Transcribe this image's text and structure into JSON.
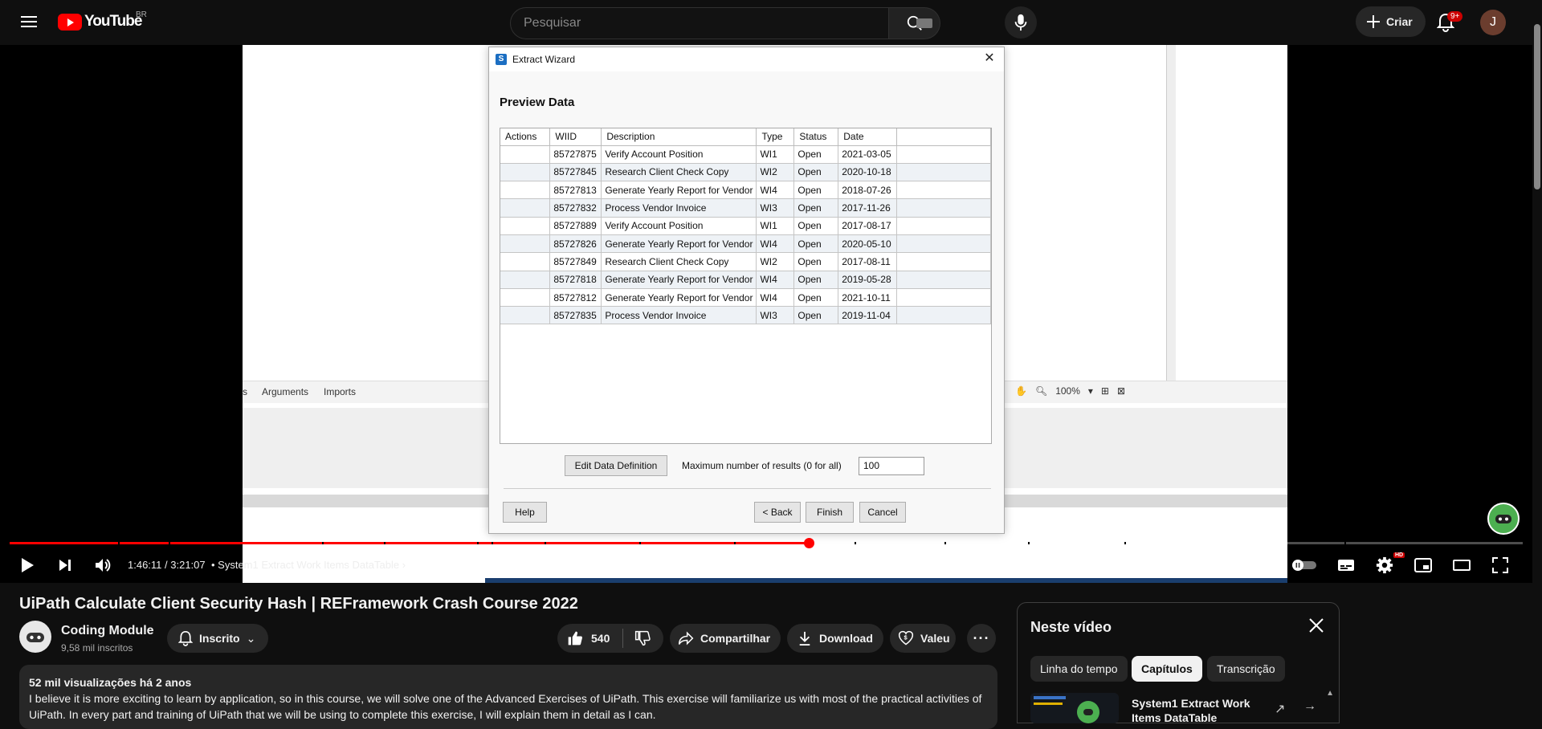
{
  "header": {
    "logo_text": "YouTube",
    "country_code": "BR",
    "search_placeholder": "Pesquisar",
    "create_label": "Criar",
    "notification_count": "9+",
    "avatar_letter": "J"
  },
  "video_frame": {
    "studio_tabs": [
      "s",
      "Arguments",
      "Imports"
    ],
    "zoom_level": "100%",
    "dialog": {
      "title": "Extract Wizard",
      "heading": "Preview Data",
      "columns": [
        "Actions",
        "WIID",
        "Description",
        "Type",
        "Status",
        "Date"
      ],
      "rows": [
        [
          "",
          "85727875",
          "Verify Account Position",
          "WI1",
          "Open",
          "2021-03-05"
        ],
        [
          "",
          "85727845",
          "Research Client Check Copy",
          "WI2",
          "Open",
          "2020-10-18"
        ],
        [
          "",
          "85727813",
          "Generate Yearly Report for Vendor",
          "WI4",
          "Open",
          "2018-07-26"
        ],
        [
          "",
          "85727832",
          "Process Vendor Invoice",
          "WI3",
          "Open",
          "2017-11-26"
        ],
        [
          "",
          "85727889",
          "Verify Account Position",
          "WI1",
          "Open",
          "2017-08-17"
        ],
        [
          "",
          "85727826",
          "Generate Yearly Report for Vendor",
          "WI4",
          "Open",
          "2020-05-10"
        ],
        [
          "",
          "85727849",
          "Research Client Check Copy",
          "WI2",
          "Open",
          "2017-08-11"
        ],
        [
          "",
          "85727818",
          "Generate Yearly Report for Vendor",
          "WI4",
          "Open",
          "2019-05-28"
        ],
        [
          "",
          "85727812",
          "Generate Yearly Report for Vendor",
          "WI4",
          "Open",
          "2021-10-11"
        ],
        [
          "",
          "85727835",
          "Process Vendor Invoice",
          "WI3",
          "Open",
          "2019-11-04"
        ]
      ],
      "edit_button": "Edit Data Definition",
      "max_results_label": "Maximum number of results (0 for all)",
      "max_results_value": "100",
      "help_button": "Help",
      "back_button": "< Back",
      "finish_button": "Finish",
      "cancel_button": "Cancel"
    }
  },
  "player": {
    "time": "1:46:11 / 3:21:07",
    "chapter": "System1 Extract Work Items DataTable",
    "progress_fraction": 0.528,
    "hd_badge": "HD"
  },
  "video": {
    "title": "UiPath Calculate Client Security Hash | REFramework Crash Course 2022",
    "channel_name": "Coding Module",
    "subscribers": "9,58 mil inscritos",
    "subscribed_label": "Inscrito",
    "likes": "540",
    "share_label": "Compartilhar",
    "download_label": "Download",
    "thanks_label": "Valeu",
    "views_meta": "52 mil visualizações  há 2 anos",
    "description": "I believe it is more exciting to learn by application, so in this course, we will solve one of the Advanced Exercises of UiPath. This exercise will familiarize us with most of the practical activities of UiPath. In every part and training of UiPath that we will be using to complete this exercise, I will explain them in detail as I can."
  },
  "panel": {
    "title": "Neste vídeo",
    "tabs": [
      "Linha do tempo",
      "Capítulos",
      "Transcrição"
    ],
    "chapter_title": "System1 Extract Work Items DataTable"
  },
  "colors": {
    "brand_red": "#ff0000",
    "background": "#0f0f0f",
    "surface": "#272727"
  }
}
